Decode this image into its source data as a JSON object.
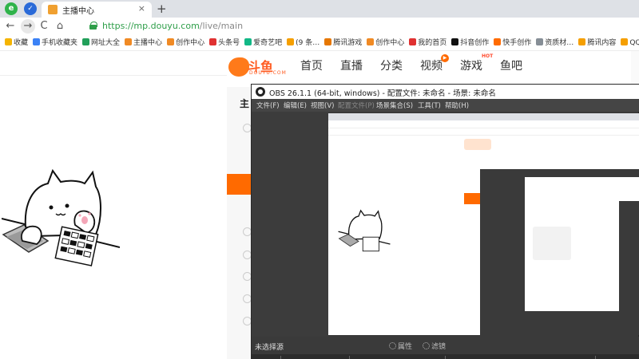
{
  "browser": {
    "tab": {
      "title": "主播中心",
      "close": "×"
    },
    "new_tab": "+",
    "nav": {
      "back": "←",
      "forward": "→",
      "reload": "C",
      "home": "⌂"
    },
    "url": {
      "host": "https://mp.douyu.com",
      "path": "/live/main"
    },
    "bookmarks": [
      {
        "label": "收藏",
        "color": "#f5b400"
      },
      {
        "label": "手机收藏夹",
        "color": "#3b82f6"
      },
      {
        "label": "网址大全",
        "color": "#22a05a"
      },
      {
        "label": "主播中心",
        "color": "#f08a24"
      },
      {
        "label": "创作中心",
        "color": "#f08a24"
      },
      {
        "label": "头条号",
        "color": "#e03131"
      },
      {
        "label": "爱奇艺吧",
        "color": "#12b886"
      },
      {
        "label": "(9 条…",
        "color": "#f59f00"
      },
      {
        "label": "腾讯游戏",
        "color": "#e67700"
      },
      {
        "label": "创作中心",
        "color": "#f08a24"
      },
      {
        "label": "我的首页",
        "color": "#e03131"
      },
      {
        "label": "抖音创作",
        "color": "#111111"
      },
      {
        "label": "快手创作",
        "color": "#ff6b00"
      },
      {
        "label": "资质材…",
        "color": "#868e96"
      },
      {
        "label": "腾讯内容",
        "color": "#f59f00"
      },
      {
        "label": "QQ邮箱",
        "color": "#f59f00"
      }
    ]
  },
  "douyu": {
    "logo": {
      "text": "斗鱼",
      "sub": "DOUYU.COM"
    },
    "nav": [
      {
        "label": "首页"
      },
      {
        "label": "直播"
      },
      {
        "label": "分类"
      },
      {
        "label": "视频",
        "badge": "▶"
      },
      {
        "label": "游戏",
        "hot": "HOT"
      },
      {
        "label": "鱼吧"
      }
    ],
    "side_title": "主"
  },
  "obs": {
    "title": "OBS 26.1.1 (64-bit, windows) - 配置文件: 未命名 - 场景: 未命名",
    "menu": [
      {
        "label": "文件(F)",
        "dim": false
      },
      {
        "label": "编辑(E)",
        "dim": false
      },
      {
        "label": "视图(V)",
        "dim": false
      },
      {
        "label": "配置文件(P)",
        "dim": true
      },
      {
        "label": "场景集合(S)",
        "dim": false
      },
      {
        "label": "工具(T)",
        "dim": false
      },
      {
        "label": "帮助(H)",
        "dim": false
      }
    ],
    "no_source": "未选择源",
    "properties": "属性",
    "filters": "滤镜"
  },
  "colors": {
    "douyu_orange": "#ff6a00",
    "url_green": "#2e9e49",
    "obs_dark": "#3a3a3a"
  }
}
